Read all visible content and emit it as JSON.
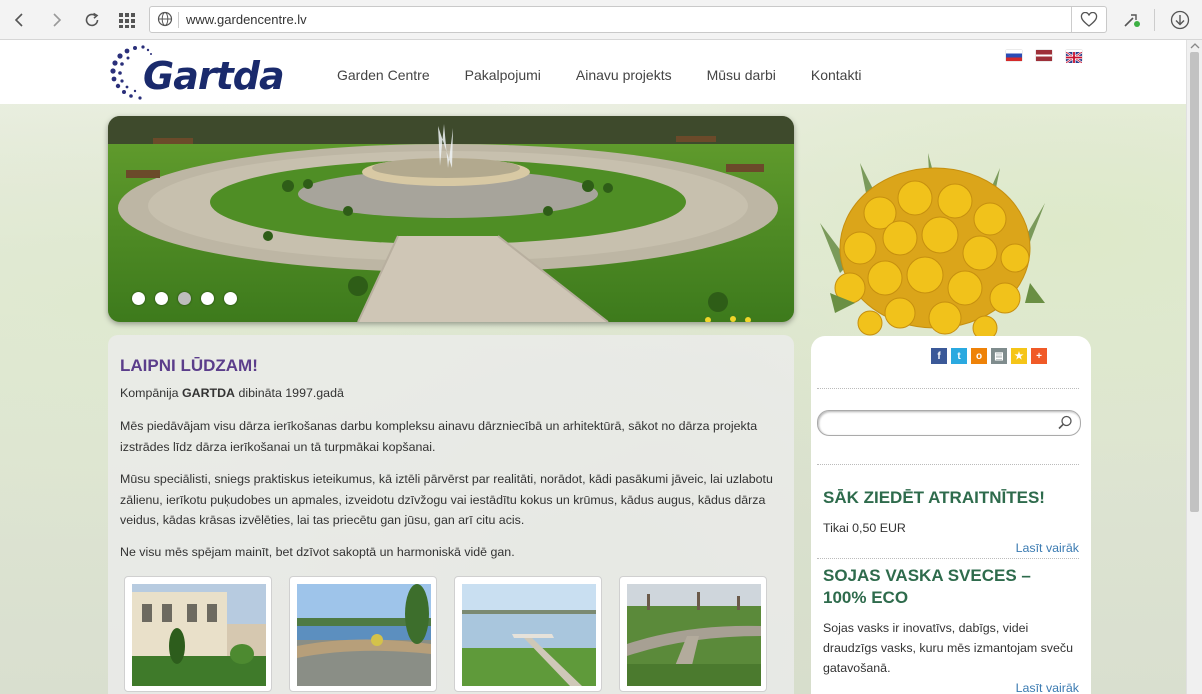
{
  "browser": {
    "url": "www.gardencentre.lv"
  },
  "site": {
    "logo_text": "Gartda",
    "menu": [
      "Garden Centre",
      "Pakalpojumi",
      "Ainavu projekts",
      "Mūsu darbi",
      "Kontakti"
    ],
    "languages": [
      "ru",
      "lv",
      "en"
    ]
  },
  "slider": {
    "slide_count": 5,
    "active_index": 2
  },
  "welcome": {
    "title": "LAIPNI LŪDZAM!",
    "founded_prefix": "Kompānija ",
    "founded_company": "GARTDA",
    "founded_suffix": " dibināta 1997.gadā",
    "para1": "Mēs piedāvājam visu dārza ierīkošanas darbu kompleksu ainavu dārzniecībā un arhitektūrā, sākot no dārza projekta izstrādes līdz dārza ierīkošanai un tā turpmākai kopšanai.",
    "para2": "Mūsu speciālisti, sniegs praktiskus ieteikumus, kā iztēli pārvērst par realitāti, norādot, kādi pasākumi jāveic, lai uzlabotu zālienu, ierīkotu puķudobes un apmales, izveidotu dzīvžogu vai iestādītu kokus un krūmus, kādus augus, kādus dārza veidus, kādas krāsas izvēlēties, lai tas priecētu gan jūsu, gan arī citu acis.",
    "para3": "Ne visu mēs spējam mainīt, bet dzīvot sakoptā un harmoniskā vidē gan."
  },
  "sidebar": {
    "share_icons": [
      "facebook-icon",
      "twitter-icon",
      "odnoklassniki-icon",
      "print-icon",
      "favorite-icon",
      "more-icon"
    ],
    "promo1": {
      "title": "SĀK ZIEDĒT ATRAITNĪTES!",
      "text": "Tikai 0,50 EUR",
      "more": "Lasīt vairāk"
    },
    "promo2": {
      "title": "SOJAS VASKA SVECES – 100% ECO",
      "text": "Sojas vasks ir inovatīvs, dabīgs, videi draudzīgs vasks, kuru mēs izmantojam sveču gatavošanā.",
      "more": "Lasīt vairāk"
    }
  }
}
